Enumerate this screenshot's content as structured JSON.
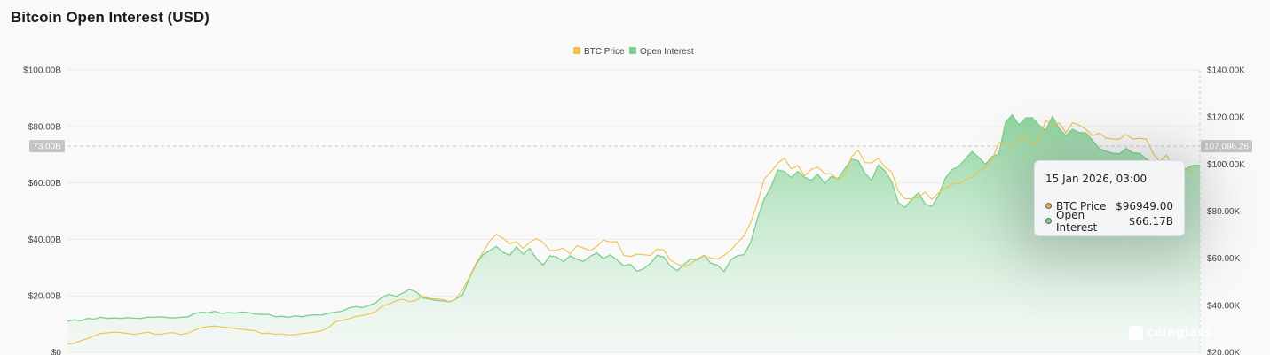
{
  "title": "Bitcoin Open Interest (USD)",
  "colors": {
    "btc_price": "#f0c14b",
    "open_interest": "#7ccf8e",
    "open_interest_fill": "#a8e2bb"
  },
  "chart_data": {
    "type": "area",
    "legend": [
      "BTC Price",
      "Open Interest"
    ],
    "legend_position": "top-center",
    "y_left": {
      "ticks": [
        "$0",
        "$20.00B",
        "$40.00B",
        "$60.00B",
        "$80.00B",
        "$100.00B"
      ],
      "range": [
        0,
        100
      ],
      "unit": "B"
    },
    "y_right": {
      "ticks": [
        "$20.00K",
        "$40.00K",
        "$60.00K",
        "$80.00K",
        "$100.00K",
        "$120.00K",
        "$140.00K"
      ],
      "range": [
        20000,
        140000
      ]
    },
    "crosshair": {
      "left_label": "73.00B",
      "left_value": 73,
      "right_label": "107,096.26",
      "right_value": 107096.26
    },
    "grid": true,
    "series": [
      {
        "name": "Open Interest",
        "axis": "left",
        "values": [
          11,
          11.5,
          11.2,
          12,
          11.8,
          12.4,
          12,
          12.2,
          12,
          12.3,
          12.1,
          12,
          12.5,
          12.4,
          12.6,
          12.3,
          12.2,
          12.4,
          12.6,
          13.8,
          14.2,
          14,
          14.5,
          13.8,
          14.1,
          13.9,
          14.3,
          14.1,
          13.6,
          13.4,
          13.5,
          12.6,
          12.8,
          12.4,
          12.9,
          12.6,
          13.1,
          13.3,
          13.2,
          13.9,
          14.2,
          14.6,
          15.7,
          16.2,
          15.8,
          16.6,
          17.6,
          19.6,
          20.6,
          19.8,
          20.9,
          22.3,
          21.5,
          19.3,
          18.9,
          18.4,
          18.2,
          17.9,
          18.9,
          20.4,
          26.4,
          31.3,
          34.5,
          36,
          37.5,
          35.5,
          34.4,
          37.4,
          34.8,
          36.8,
          33.1,
          30.9,
          34.2,
          33.8,
          32.1,
          34.2,
          33,
          32.2,
          34,
          35.2,
          33.2,
          34.5,
          32.8,
          30.6,
          31.2,
          28.7,
          29.6,
          31.5,
          34.4,
          33.7,
          30.5,
          28.9,
          31.1,
          33.1,
          32.7,
          34.4,
          31.6,
          30.9,
          28.6,
          32.8,
          34.3,
          34.6,
          39.1,
          47.6,
          54.3,
          58.6,
          64.6,
          64,
          61.9,
          64.1,
          62,
          60.9,
          63.1,
          59.8,
          62.3,
          61.5,
          65,
          68.4,
          67.9,
          63.5,
          60.8,
          66.3,
          64.3,
          60.5,
          53,
          51.3,
          54.2,
          56.5,
          52.6,
          51.7,
          55.5,
          61.6,
          64.7,
          65.8,
          68.4,
          71.1,
          69,
          66.6,
          69.3,
          70.2,
          81.5,
          84.1,
          80.5,
          83,
          83.1,
          80.4,
          78.6,
          83.6,
          79.2,
          76.7,
          79,
          77.8,
          77.7,
          75,
          72.1,
          71.2,
          70.5,
          70.3,
          72.2,
          70.6,
          70.5,
          68.4,
          67.2,
          66.1,
          65,
          65.5,
          63,
          65,
          66.2,
          66.2
        ]
      },
      {
        "name": "BTC Price",
        "axis": "right",
        "values": [
          23500,
          23800,
          25000,
          25800,
          27000,
          28000,
          28300,
          28600,
          28400,
          28000,
          27700,
          28100,
          28600,
          27800,
          27700,
          28300,
          28300,
          27600,
          28200,
          29500,
          30500,
          31000,
          31200,
          30800,
          30500,
          30200,
          29800,
          29500,
          29200,
          28000,
          28200,
          27700,
          27900,
          27300,
          27600,
          28000,
          28300,
          28700,
          29200,
          30600,
          33000,
          33600,
          34300,
          35200,
          35600,
          36300,
          37300,
          39700,
          40500,
          41900,
          42600,
          41600,
          42000,
          43800,
          43000,
          42700,
          42500,
          41500,
          42800,
          46800,
          52000,
          58000,
          62400,
          67300,
          70100,
          68500,
          66100,
          67000,
          64200,
          66800,
          68300,
          66700,
          63200,
          63400,
          64300,
          61800,
          65300,
          64300,
          63200,
          65000,
          67700,
          66900,
          67100,
          61300,
          60700,
          61700,
          61500,
          61200,
          63900,
          63500,
          59200,
          57500,
          56500,
          57500,
          59800,
          61000,
          60100,
          59700,
          61200,
          63500,
          66600,
          69600,
          75500,
          83800,
          93700,
          96700,
          100400,
          102500,
          98000,
          99300,
          95000,
          97700,
          98700,
          96000,
          95900,
          93400,
          95400,
          103100,
          105900,
          100600,
          100500,
          102500,
          98700,
          96700,
          88400,
          85300,
          85300,
          85900,
          88100,
          85000,
          87800,
          89600,
          91400,
          91800,
          93300,
          94500,
          96800,
          98600,
          101800,
          109200,
          108800,
          107000,
          110600,
          112200,
          108000,
          110100,
          118600,
          116400,
          117500,
          113200,
          117500,
          116600,
          114800,
          112000,
          113200,
          111000,
          110700,
          110600,
          112600,
          110600,
          111000,
          110500,
          104600,
          101000,
          103800,
          98700,
          99500,
          97900,
          96949
        ]
      }
    ],
    "tooltip": {
      "date": "15 Jan 2026, 03:00",
      "rows": [
        {
          "name": "BTC Price",
          "value": "$96949.00",
          "color": "#f0c14b"
        },
        {
          "name": "Open Interest",
          "value": "$66.17B",
          "color": "#7ccf8e"
        }
      ]
    }
  },
  "watermark": "coinglass"
}
